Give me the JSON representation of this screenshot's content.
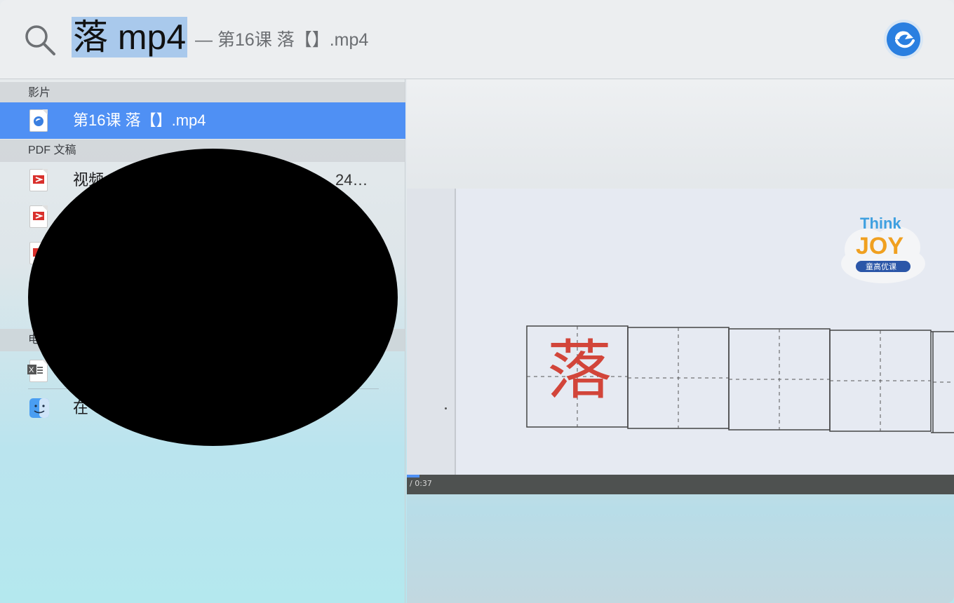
{
  "search": {
    "query": "落 mp4",
    "completion": "— 第16课 落【】.mp4"
  },
  "sections": [
    {
      "header": "影片"
    },
    {
      "header": "PDF 文稿"
    }
  ],
  "rows": [
    {
      "label": "第16课 落【】.mp4",
      "selected": true,
      "icon": "video-file-icon"
    },
    {
      "label": "视频",
      "meta": "24…",
      "icon": "pdf-file-icon"
    },
    {
      "label": "",
      "icon": "pdf-file-icon"
    },
    {
      "label": "",
      "icon": "pdf-file-icon"
    },
    {
      "label": "",
      "icon": "excel-file-icon"
    },
    {
      "label": "在",
      "icon": "finder-icon"
    }
  ],
  "partial_header": "电",
  "preview": {
    "character": "落",
    "time": "/ 0:37",
    "logo_line1": "Think",
    "logo_line2": "JOY",
    "logo_sub": "童高优课"
  },
  "colors": {
    "selection": "#4f90f4",
    "query_highlight": "#a9c9ec"
  }
}
